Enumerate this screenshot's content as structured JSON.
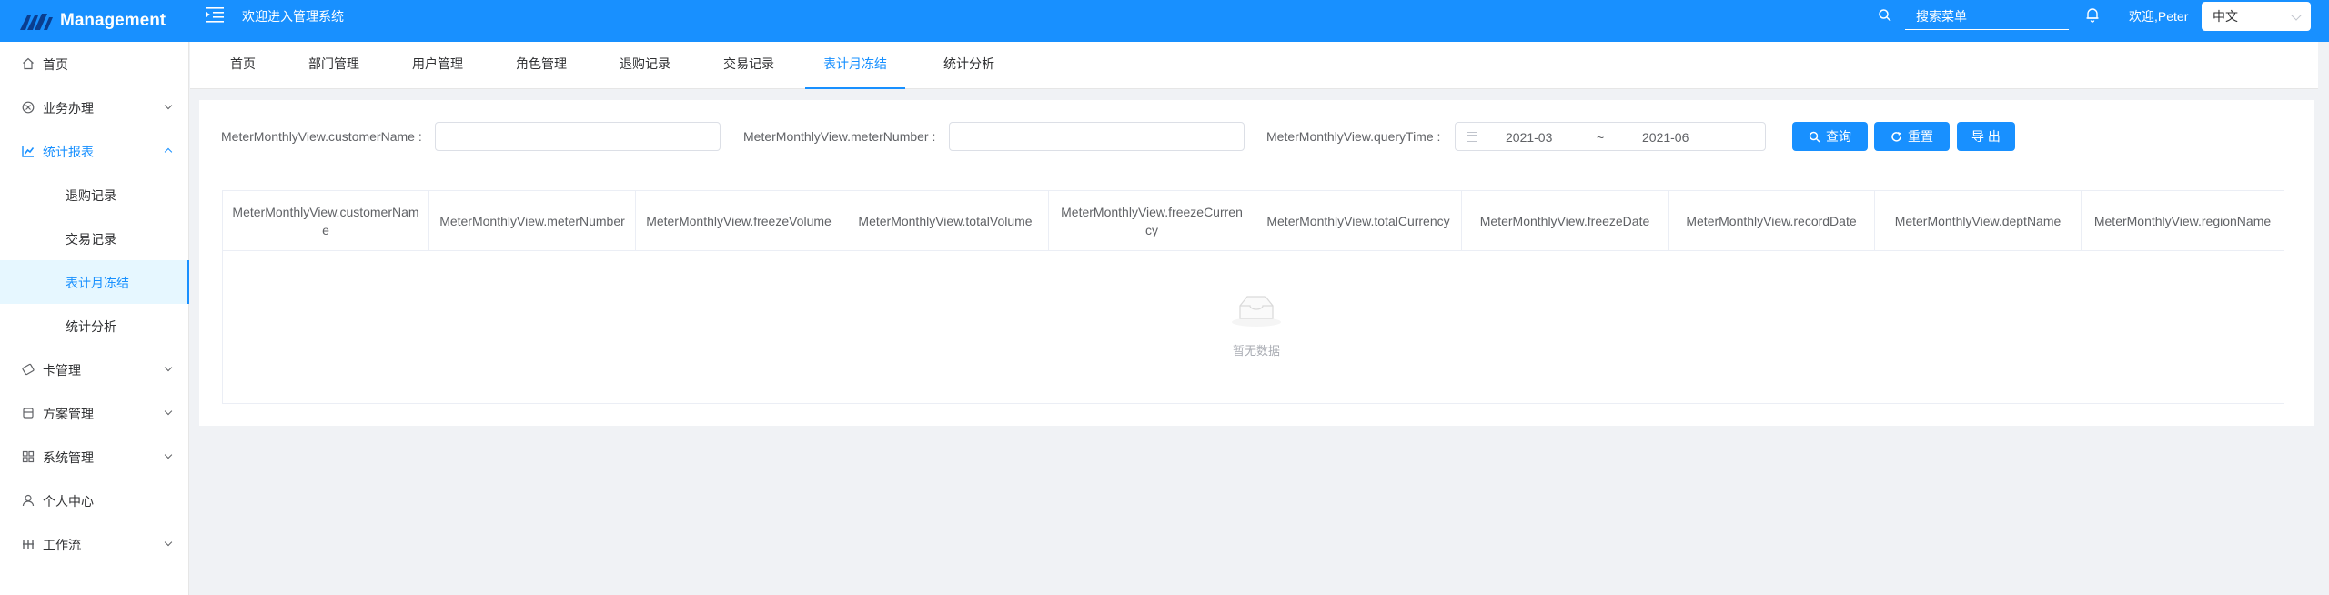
{
  "header": {
    "app_name": "Management",
    "welcome": "欢迎进入管理系统",
    "search_placeholder": "搜索菜单",
    "user": "欢迎,Peter",
    "language": "中文",
    "brand_color": "#1890ff"
  },
  "sidebar": {
    "items": [
      {
        "label": "首页",
        "icon": "home-icon"
      },
      {
        "label": "业务办理",
        "icon": "business-icon"
      },
      {
        "label": "统计报表",
        "icon": "chart-icon"
      },
      {
        "label": "卡管理",
        "icon": "card-icon"
      },
      {
        "label": "方案管理",
        "icon": "plan-icon"
      },
      {
        "label": "系统管理",
        "icon": "system-icon"
      },
      {
        "label": "个人中心",
        "icon": "user-icon"
      },
      {
        "label": "工作流",
        "icon": "workflow-icon"
      }
    ],
    "subitems": [
      {
        "label": "退购记录"
      },
      {
        "label": "交易记录"
      },
      {
        "label": "表计月冻结"
      },
      {
        "label": "统计分析"
      }
    ]
  },
  "tabs": [
    {
      "label": "首页"
    },
    {
      "label": "部门管理"
    },
    {
      "label": "用户管理"
    },
    {
      "label": "角色管理"
    },
    {
      "label": "退购记录"
    },
    {
      "label": "交易记录"
    },
    {
      "label": "表计月冻结"
    },
    {
      "label": "统计分析"
    }
  ],
  "filters": {
    "customer_name_label": "MeterMonthlyView.customerName :",
    "customer_name_value": "",
    "meter_number_label": "MeterMonthlyView.meterNumber :",
    "meter_number_value": "",
    "query_time_label": "MeterMonthlyView.queryTime :",
    "range_start": "2021-03",
    "range_separator": "~",
    "range_end": "2021-06"
  },
  "buttons": {
    "search": "查询",
    "reset": "重置",
    "export": "导 出"
  },
  "table": {
    "columns": [
      "MeterMonthlyView.customerName",
      "MeterMonthlyView.meterNumber",
      "MeterMonthlyView.freezeVolume",
      "MeterMonthlyView.totalVolume",
      "MeterMonthlyView.freezeCurrency",
      "MeterMonthlyView.totalCurrency",
      "MeterMonthlyView.freezeDate",
      "MeterMonthlyView.recordDate",
      "MeterMonthlyView.deptName",
      "MeterMonthlyView.regionName"
    ],
    "empty_text": "暂无数据"
  }
}
